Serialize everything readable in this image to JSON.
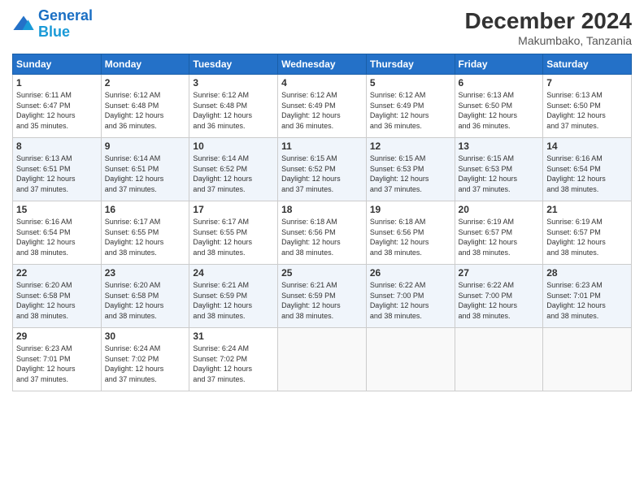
{
  "header": {
    "logo_line1": "General",
    "logo_line2": "Blue",
    "month_year": "December 2024",
    "location": "Makumbako, Tanzania"
  },
  "days_of_week": [
    "Sunday",
    "Monday",
    "Tuesday",
    "Wednesday",
    "Thursday",
    "Friday",
    "Saturday"
  ],
  "weeks": [
    [
      {
        "day": 1,
        "info": "Sunrise: 6:11 AM\nSunset: 6:47 PM\nDaylight: 12 hours\nand 35 minutes."
      },
      {
        "day": 2,
        "info": "Sunrise: 6:12 AM\nSunset: 6:48 PM\nDaylight: 12 hours\nand 36 minutes."
      },
      {
        "day": 3,
        "info": "Sunrise: 6:12 AM\nSunset: 6:48 PM\nDaylight: 12 hours\nand 36 minutes."
      },
      {
        "day": 4,
        "info": "Sunrise: 6:12 AM\nSunset: 6:49 PM\nDaylight: 12 hours\nand 36 minutes."
      },
      {
        "day": 5,
        "info": "Sunrise: 6:12 AM\nSunset: 6:49 PM\nDaylight: 12 hours\nand 36 minutes."
      },
      {
        "day": 6,
        "info": "Sunrise: 6:13 AM\nSunset: 6:50 PM\nDaylight: 12 hours\nand 36 minutes."
      },
      {
        "day": 7,
        "info": "Sunrise: 6:13 AM\nSunset: 6:50 PM\nDaylight: 12 hours\nand 37 minutes."
      }
    ],
    [
      {
        "day": 8,
        "info": "Sunrise: 6:13 AM\nSunset: 6:51 PM\nDaylight: 12 hours\nand 37 minutes."
      },
      {
        "day": 9,
        "info": "Sunrise: 6:14 AM\nSunset: 6:51 PM\nDaylight: 12 hours\nand 37 minutes."
      },
      {
        "day": 10,
        "info": "Sunrise: 6:14 AM\nSunset: 6:52 PM\nDaylight: 12 hours\nand 37 minutes."
      },
      {
        "day": 11,
        "info": "Sunrise: 6:15 AM\nSunset: 6:52 PM\nDaylight: 12 hours\nand 37 minutes."
      },
      {
        "day": 12,
        "info": "Sunrise: 6:15 AM\nSunset: 6:53 PM\nDaylight: 12 hours\nand 37 minutes."
      },
      {
        "day": 13,
        "info": "Sunrise: 6:15 AM\nSunset: 6:53 PM\nDaylight: 12 hours\nand 37 minutes."
      },
      {
        "day": 14,
        "info": "Sunrise: 6:16 AM\nSunset: 6:54 PM\nDaylight: 12 hours\nand 38 minutes."
      }
    ],
    [
      {
        "day": 15,
        "info": "Sunrise: 6:16 AM\nSunset: 6:54 PM\nDaylight: 12 hours\nand 38 minutes."
      },
      {
        "day": 16,
        "info": "Sunrise: 6:17 AM\nSunset: 6:55 PM\nDaylight: 12 hours\nand 38 minutes."
      },
      {
        "day": 17,
        "info": "Sunrise: 6:17 AM\nSunset: 6:55 PM\nDaylight: 12 hours\nand 38 minutes."
      },
      {
        "day": 18,
        "info": "Sunrise: 6:18 AM\nSunset: 6:56 PM\nDaylight: 12 hours\nand 38 minutes."
      },
      {
        "day": 19,
        "info": "Sunrise: 6:18 AM\nSunset: 6:56 PM\nDaylight: 12 hours\nand 38 minutes."
      },
      {
        "day": 20,
        "info": "Sunrise: 6:19 AM\nSunset: 6:57 PM\nDaylight: 12 hours\nand 38 minutes."
      },
      {
        "day": 21,
        "info": "Sunrise: 6:19 AM\nSunset: 6:57 PM\nDaylight: 12 hours\nand 38 minutes."
      }
    ],
    [
      {
        "day": 22,
        "info": "Sunrise: 6:20 AM\nSunset: 6:58 PM\nDaylight: 12 hours\nand 38 minutes."
      },
      {
        "day": 23,
        "info": "Sunrise: 6:20 AM\nSunset: 6:58 PM\nDaylight: 12 hours\nand 38 minutes."
      },
      {
        "day": 24,
        "info": "Sunrise: 6:21 AM\nSunset: 6:59 PM\nDaylight: 12 hours\nand 38 minutes."
      },
      {
        "day": 25,
        "info": "Sunrise: 6:21 AM\nSunset: 6:59 PM\nDaylight: 12 hours\nand 38 minutes."
      },
      {
        "day": 26,
        "info": "Sunrise: 6:22 AM\nSunset: 7:00 PM\nDaylight: 12 hours\nand 38 minutes."
      },
      {
        "day": 27,
        "info": "Sunrise: 6:22 AM\nSunset: 7:00 PM\nDaylight: 12 hours\nand 38 minutes."
      },
      {
        "day": 28,
        "info": "Sunrise: 6:23 AM\nSunset: 7:01 PM\nDaylight: 12 hours\nand 38 minutes."
      }
    ],
    [
      {
        "day": 29,
        "info": "Sunrise: 6:23 AM\nSunset: 7:01 PM\nDaylight: 12 hours\nand 37 minutes."
      },
      {
        "day": 30,
        "info": "Sunrise: 6:24 AM\nSunset: 7:02 PM\nDaylight: 12 hours\nand 37 minutes."
      },
      {
        "day": 31,
        "info": "Sunrise: 6:24 AM\nSunset: 7:02 PM\nDaylight: 12 hours\nand 37 minutes."
      },
      null,
      null,
      null,
      null
    ]
  ]
}
